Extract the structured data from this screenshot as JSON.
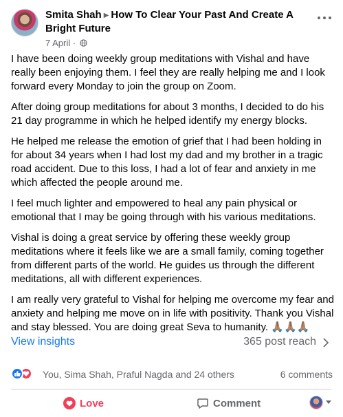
{
  "header": {
    "author": "Smita Shah",
    "group": "How To Clear Your Past And Create A Bright Future",
    "date": "7 April",
    "separator": "·"
  },
  "post_body": {
    "paragraphs": [
      "I have been doing weekly group meditations with Vishal and have really been enjoying them. I feel they are really helping me and I look forward every Monday to join the group on Zoom.",
      "After doing group meditations for about 3 months, I decided to do his 21 day programme in which he helped identify my energy blocks.",
      "He helped me release the emotion of grief that I had been holding in for about 34 years when I had lost my dad and my brother in a tragic road accident. Due to this loss, I had a lot of fear and anxiety in me which affected the people around me.",
      "I feel much lighter and empowered to heal any pain physical or emotional that I may be going through with his various meditations.",
      "Vishal is doing a great service by offering these weekly group meditations where it feels like we are a small family, coming together from different parts of the world. He guides us through the different meditations, all with different experiences.",
      "I am really very grateful to Vishal for helping me overcome my fear and anxiety and helping me move on in life with positivity. Thank you Vishal and stay blessed. You are doing great Seva to humanity. 🙏🏽🙏🏽🙏🏽"
    ]
  },
  "insights": {
    "link_label": "View insights",
    "reach_label": "365 post reach"
  },
  "reactions": {
    "names": "You, Sima Shah, Praful Nagda and 24 others",
    "comments": "6 comments"
  },
  "actions": {
    "love_label": "Love",
    "comment_label": "Comment"
  },
  "colors": {
    "accent_blue": "#1877f2",
    "love_red": "#f33e58",
    "secondary_text": "#65676b"
  },
  "icons": [
    "more-options-icon",
    "globe-icon",
    "chevron-right-icon",
    "like-reaction-icon",
    "love-reaction-icon",
    "heart-icon",
    "comment-icon"
  ]
}
